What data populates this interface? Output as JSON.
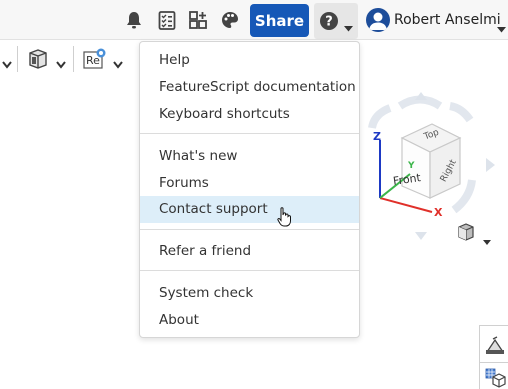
{
  "header": {
    "share_label": "Share",
    "user_name": "Robert Anselmi",
    "icons": [
      "bell-icon",
      "checklist-icon",
      "add-grid-icon",
      "palette-icon",
      "help-circle-icon",
      "user-avatar-icon"
    ]
  },
  "toolbar": {
    "tool_text": "Re"
  },
  "help_menu": {
    "items": [
      {
        "label": "Help"
      },
      {
        "label": "FeatureScript documentation"
      },
      {
        "label": "Keyboard shortcuts"
      },
      {
        "label": "What's new"
      },
      {
        "label": "Forums"
      },
      {
        "label": "Contact support"
      },
      {
        "label": "Refer a friend"
      },
      {
        "label": "System check"
      },
      {
        "label": "About"
      }
    ],
    "highlighted": "Contact support"
  },
  "view_cube": {
    "faces": {
      "top": "Top",
      "front": "Front",
      "right": "Right"
    },
    "axes": {
      "x": "X",
      "y": "Y",
      "z": "Z"
    }
  },
  "colors": {
    "share_button": "#1658b7",
    "menu_highlight": "#ddeef9",
    "axis_x": "#e0302a",
    "axis_y": "#3bb54a",
    "axis_z": "#1d39c4"
  }
}
